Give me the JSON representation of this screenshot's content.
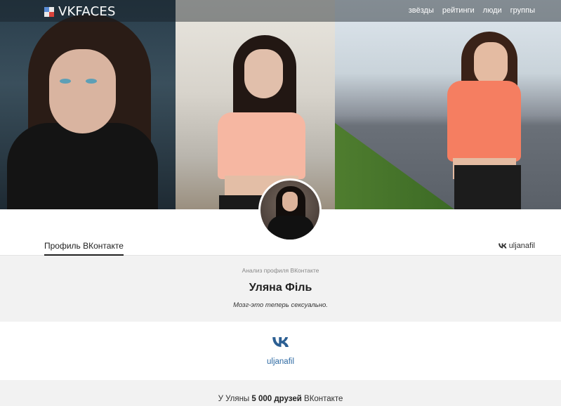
{
  "header": {
    "logo_text": "VKFACES",
    "nav": [
      "звёзды",
      "рейтинги",
      "люди",
      "группы"
    ]
  },
  "tabs": {
    "profile_tab": "Профиль ВКонтакте",
    "vk_username": "uljanafil"
  },
  "profile": {
    "analysis_label": "Анализ профиля ВКонтакте",
    "name": "Уляна Філь",
    "status": "Мозг-это теперь сексуально.",
    "vk_handle": "uljanafil"
  },
  "friends": {
    "prefix": "У Уляны ",
    "count_text": "5 000 друзей",
    "suffix": " ВКонтакте"
  },
  "colors": {
    "accent_link": "#2e6aa3",
    "vk_icon": "#2c5f93",
    "logo_blue": "#5b8dd6",
    "logo_red": "#d9443c"
  },
  "icons": [
    "vkfaces-logo-icon",
    "vk-logo-icon"
  ]
}
